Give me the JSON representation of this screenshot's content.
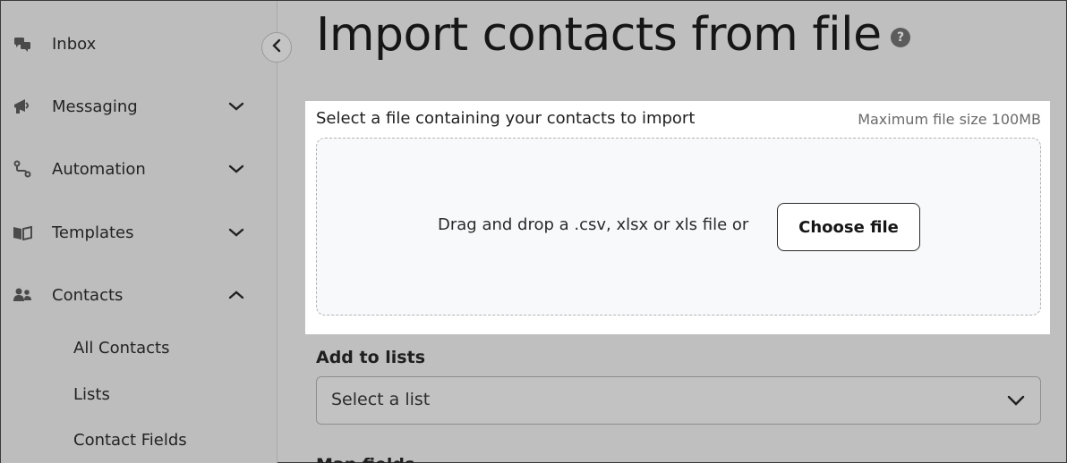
{
  "sidebar": {
    "items": [
      {
        "label": "Inbox",
        "icon": "chat-bubbles-icon"
      },
      {
        "label": "Messaging",
        "icon": "megaphone-icon",
        "expanded": false
      },
      {
        "label": "Automation",
        "icon": "flow-path-icon",
        "expanded": false
      },
      {
        "label": "Templates",
        "icon": "book-open-icon",
        "expanded": false
      },
      {
        "label": "Contacts",
        "icon": "users-icon",
        "expanded": true
      }
    ],
    "contacts_subitems": [
      "All Contacts",
      "Lists",
      "Contact Fields"
    ]
  },
  "main": {
    "title": "Import contacts from file",
    "upload": {
      "label": "Select a file containing your contacts to import",
      "limit": "Maximum file size 100MB",
      "drop_text": "Drag and drop a .csv, xlsx or xls file or",
      "choose_button": "Choose file"
    },
    "lists": {
      "label": "Add to lists",
      "placeholder": "Select a list"
    },
    "map_fields_label": "Map fields"
  },
  "colors": {
    "overlay_bg": "#bfbfbf",
    "panel_bg": "#ffffff",
    "dropzone_bg": "#f8f9fa"
  }
}
